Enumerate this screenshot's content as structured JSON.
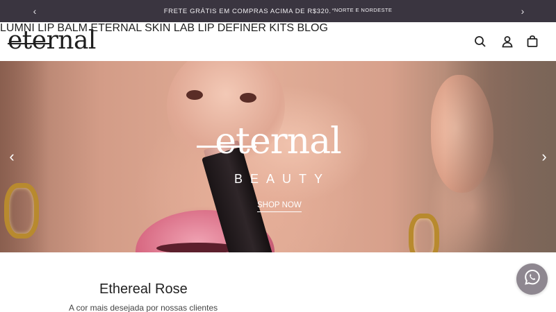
{
  "announcement": {
    "prev_icon": "chevron-left-icon",
    "next_icon": "chevron-right-icon",
    "text": "FRETE GRÁTIS EM COMPRAS ACIMA DE R$320.",
    "suffix": "*NORTE E NORDESTE",
    "background": "#3a3540"
  },
  "header": {
    "logo": "eternal",
    "nav": [
      {
        "label": "LUMNI LIP BALM"
      },
      {
        "label": "ETERNAL SKIN LAB"
      },
      {
        "label": "LIP DEFINER"
      },
      {
        "label": "KITS"
      },
      {
        "label": "BLOG"
      }
    ],
    "icons": [
      "search-icon",
      "user-icon",
      "bag-icon"
    ]
  },
  "hero": {
    "logo": "eternal",
    "subtitle": "BEAUTY",
    "cta": "SHOP NOW",
    "prev_icon": "chevron-left-icon",
    "next_icon": "chevron-right-icon"
  },
  "product": {
    "title": "Ethereal Rose",
    "subtitle": "A cor mais desejada por nossas clientes"
  },
  "whatsapp": {
    "icon": "whatsapp-icon",
    "color": "#8e8790"
  }
}
